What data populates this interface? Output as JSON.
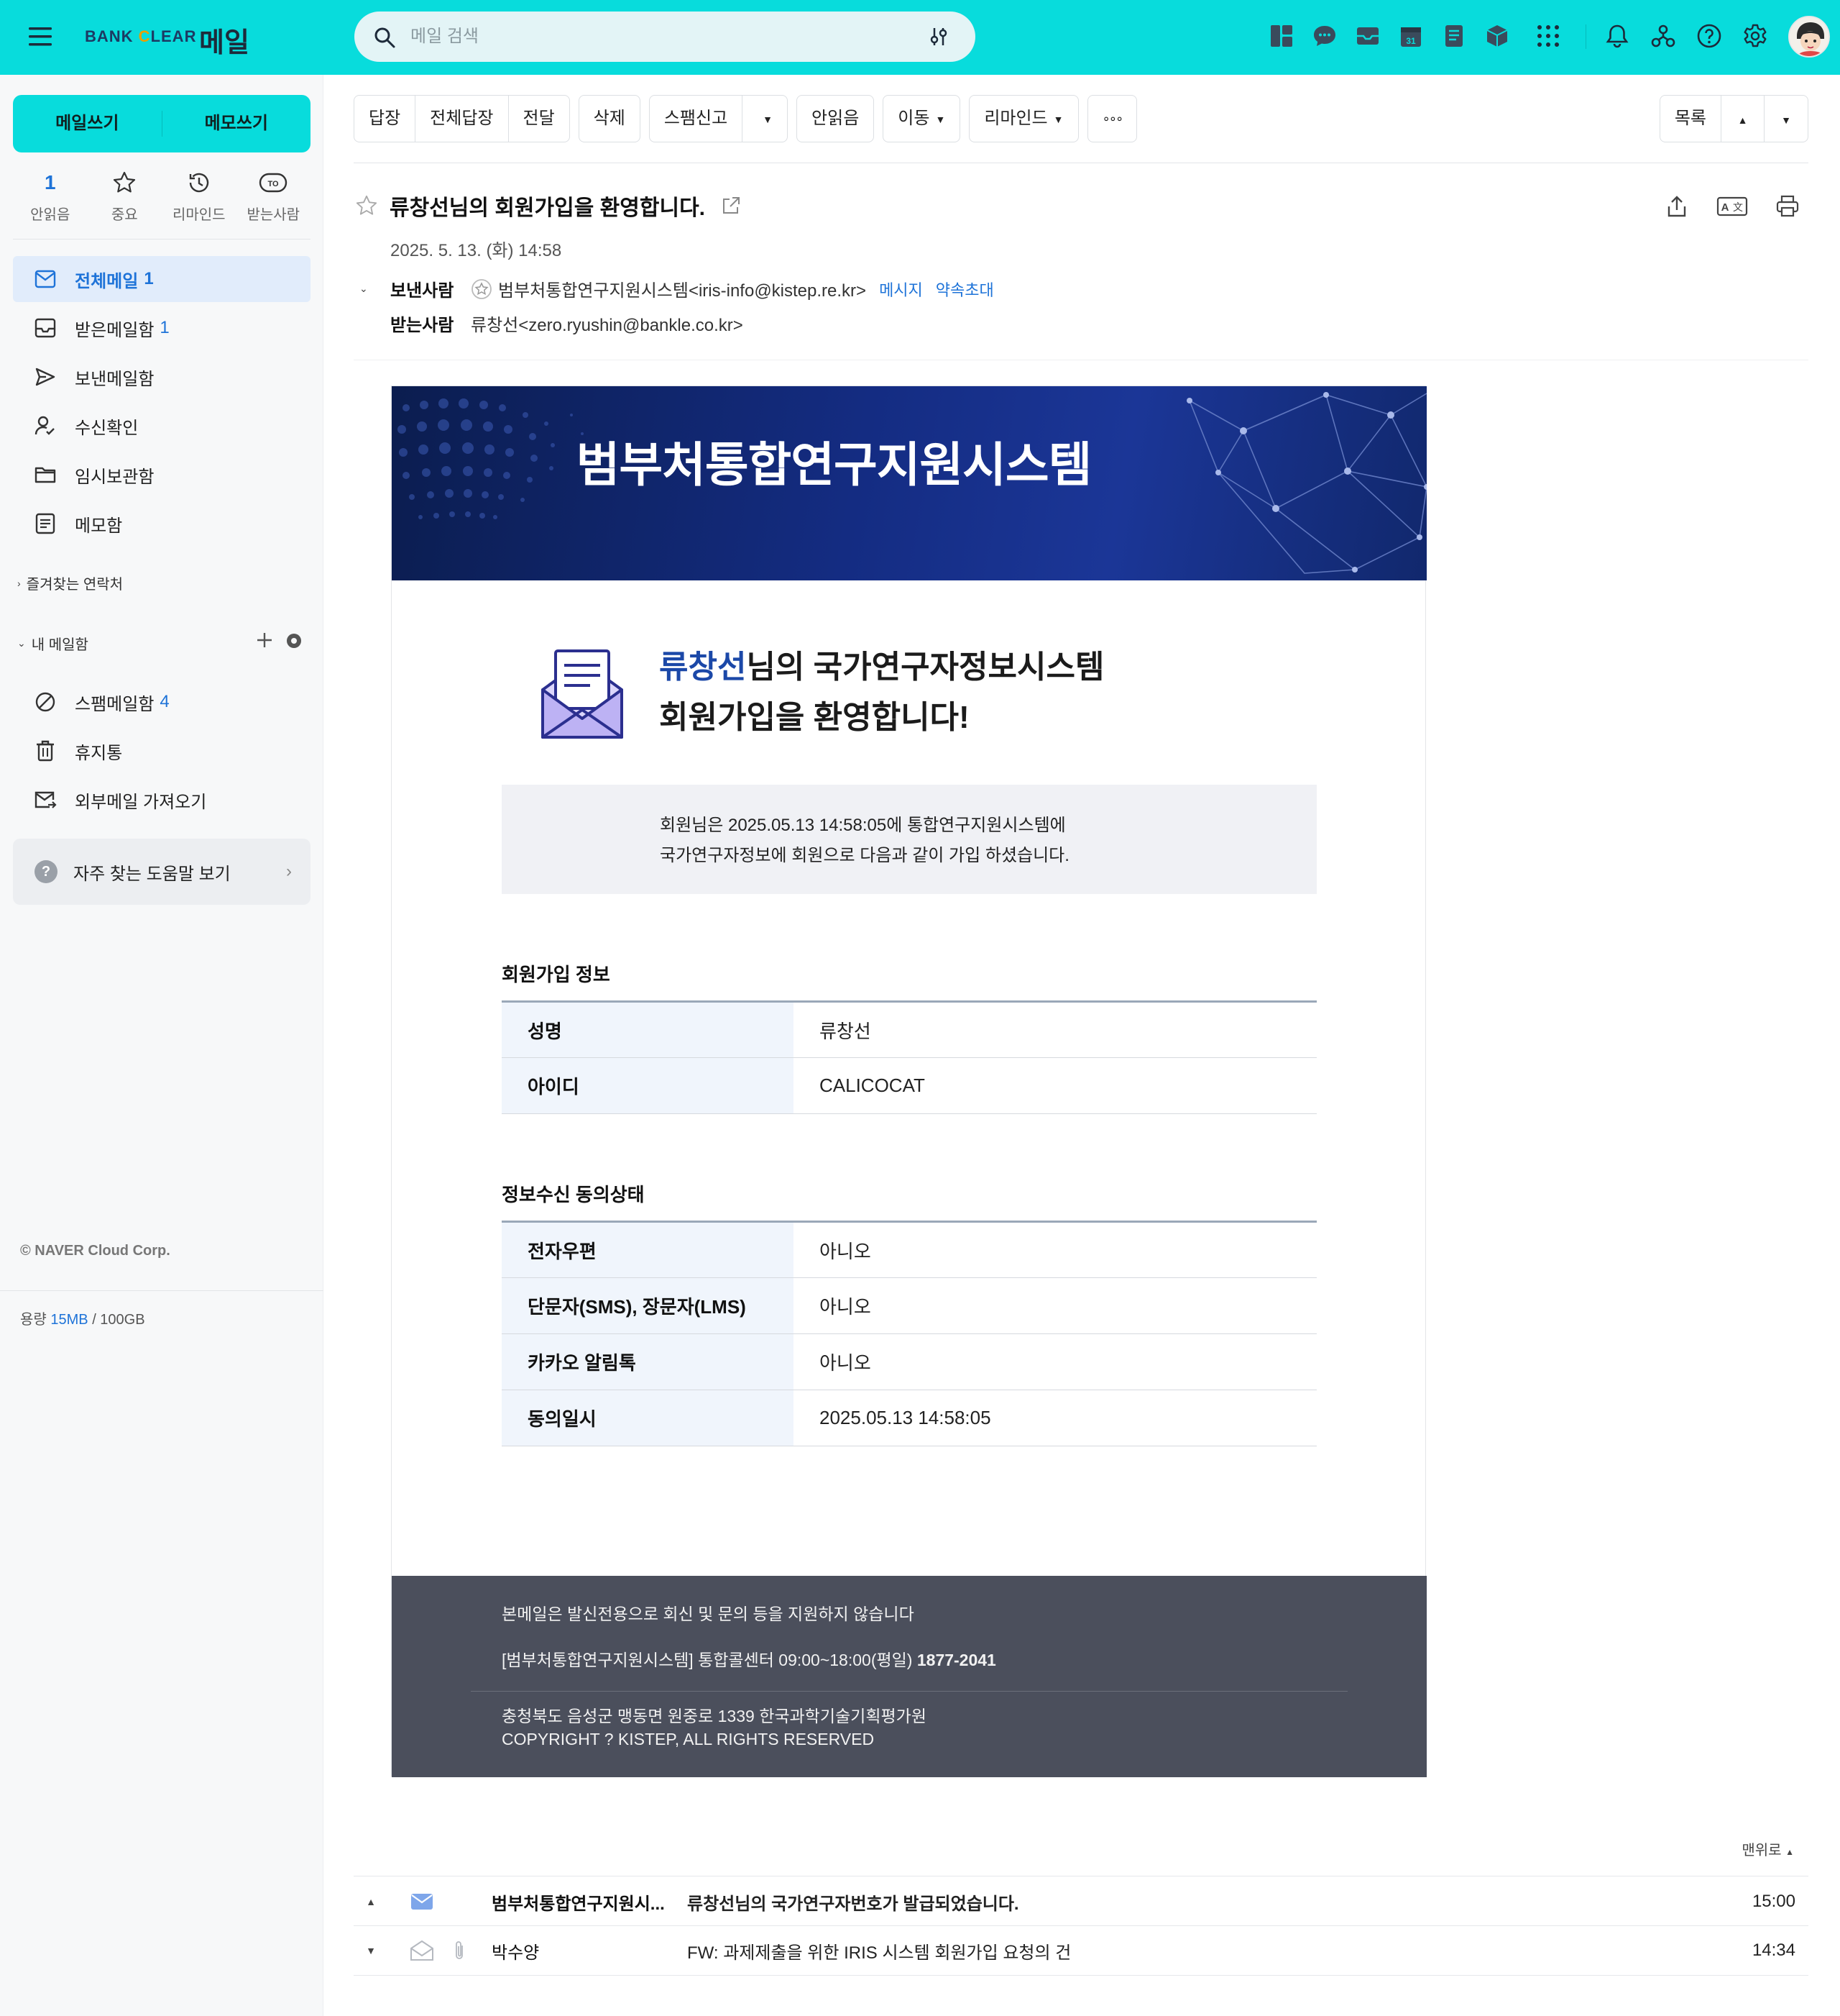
{
  "app": {
    "brand": "BANK CLEAR",
    "title": "메일",
    "search_placeholder": "메일 검색"
  },
  "topbar_icons": [
    "dashboard-icon",
    "chat-icon",
    "mail-icon",
    "calendar-icon",
    "note-icon",
    "box-icon",
    "apps-grid-icon",
    "bell-icon",
    "organization-icon",
    "help-icon",
    "settings-icon"
  ],
  "sidebar": {
    "write_mail": "메일쓰기",
    "write_memo": "메모쓰기",
    "quick": [
      {
        "label": "안읽음",
        "value": "1"
      },
      {
        "label": "중요",
        "icon": "star-icon"
      },
      {
        "label": "리마인드",
        "icon": "clock-icon"
      },
      {
        "label": "받는사람",
        "icon": "to-icon"
      }
    ],
    "folders": [
      {
        "label": "전체메일",
        "count": "1",
        "icon": "all-mail-icon",
        "active": true
      },
      {
        "label": "받은메일함",
        "count": "1",
        "icon": "inbox-icon"
      },
      {
        "label": "보낸메일함",
        "count": "",
        "icon": "sent-icon"
      },
      {
        "label": "수신확인",
        "count": "",
        "icon": "receipt-icon"
      },
      {
        "label": "임시보관함",
        "count": "",
        "icon": "draft-folder-icon"
      },
      {
        "label": "메모함",
        "count": "",
        "icon": "memo-icon"
      }
    ],
    "favorites_label": "즐겨찾는 연락처",
    "my_mailbox_label": "내 메일함",
    "my_folders": [
      {
        "label": "스팸메일함",
        "count": "4",
        "icon": "spam-icon"
      },
      {
        "label": "휴지통",
        "count": "",
        "icon": "trash-icon"
      },
      {
        "label": "외부메일 가져오기",
        "count": "",
        "icon": "external-mail-icon"
      }
    ],
    "help": "자주 찾는 도움말 보기",
    "copyright": "© NAVER Cloud Corp.",
    "storage_label": "용량",
    "storage_used": "15MB",
    "storage_total": "/ 100GB"
  },
  "toolbar": {
    "reply": "답장",
    "reply_all": "전체답장",
    "forward": "전달",
    "delete": "삭제",
    "spam": "스팸신고",
    "unread": "안읽음",
    "move": "이동",
    "remind": "리마인드",
    "more": "∘∘∘",
    "list": "목록"
  },
  "mail": {
    "subject": "류창선님의 회원가입을 환영합니다.",
    "date": "2025. 5. 13. (화) 14:58",
    "from_label": "보낸사람",
    "from": "범부처통합연구지원시스템<iris-info@kistep.re.kr>",
    "message_link": "메시지",
    "invite_link": "약속초대",
    "to_label": "받는사람",
    "to": "류창선<zero.ryushin@bankle.co.kr>"
  },
  "body": {
    "banner_title": "범부처통합연구지원시스템",
    "welcome_name": "류창선",
    "welcome_line1_rest": "님의 국가연구자정보시스템",
    "welcome_line2": "회원가입을 환영합니다!",
    "notice_line1": "회원님은 2025.05.13 14:58:05에 통합연구지원시스템에",
    "notice_line2": "국가연구자정보에 회원으로 다음과 같이 가입 하셨습니다.",
    "signup_title": "회원가입 정보",
    "signup_rows": [
      {
        "k": "성명",
        "v": "류창선"
      },
      {
        "k": "아이디",
        "v": "CALICOCAT"
      }
    ],
    "consent_title": "정보수신 동의상태",
    "consent_rows": [
      {
        "k": "전자우편",
        "v": "아니오"
      },
      {
        "k": "단문자(SMS), 장문자(LMS)",
        "v": "아니오"
      },
      {
        "k": "카카오 알림톡",
        "v": "아니오"
      },
      {
        "k": "동의일시",
        "v": "2025.05.13 14:58:05"
      }
    ],
    "footer_line1": "본메일은 발신전용으로 회신 및 문의 등을 지원하지 않습니다",
    "footer_line2": "[범부처통합연구지원시스템] 통합콜센터 09:00~18:00(평일)",
    "footer_phone": "1877-2041",
    "footer_line3": "충청북도 음성군 맹동면 원중로 1339 한국과학기술기획평가원",
    "footer_line4": "COPYRIGHT ? KISTEP, ALL RIGHTS RESERVED"
  },
  "to_top": "맨위로",
  "nearby": [
    {
      "from": "범부처통합연구지원시...",
      "subject": "류창선님의 국가연구자번호가 발급되었습니다.",
      "time": "15:00",
      "unread": true,
      "attachment": false
    },
    {
      "from": "박수양",
      "subject": "FW: 과제제출을 위한 IRIS 시스템 회원가입 요청의 건",
      "time": "14:34",
      "unread": false,
      "attachment": true
    }
  ],
  "colors": {
    "topbar": "#08dcdc",
    "accent": "#1e73d8",
    "banner": "#142c82",
    "footer": "#4b4f5c"
  }
}
